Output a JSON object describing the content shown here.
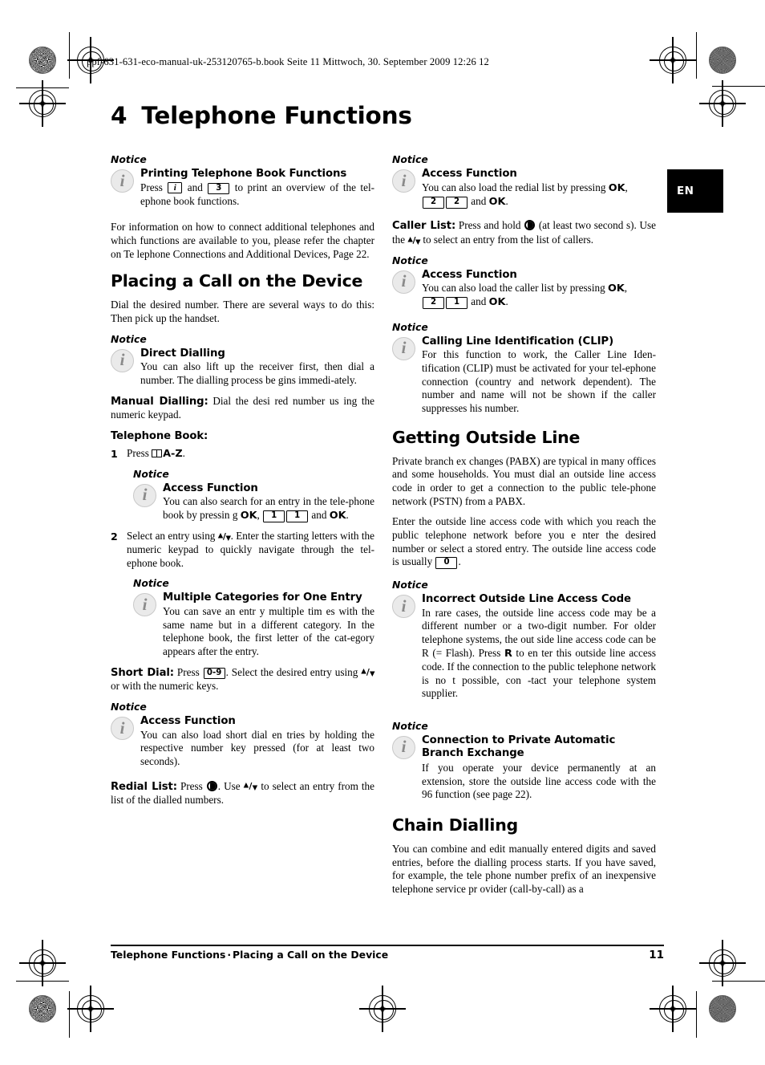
{
  "header": {
    "file_info": "ppf-631-631-eco-manual-uk-253120765-b.book  Seite 11  Mittwoch, 30. September 2009  12:26 12"
  },
  "chapter": {
    "number": "4",
    "title": "Telephone Functions"
  },
  "language_tab": {
    "label": "EN"
  },
  "left_column": {
    "notice_label_1": "Notice",
    "notice_1": {
      "title": "Printing Telephone Book Functions",
      "text_before_key1": "Press ",
      "key1": "i",
      "text_between_keys": " and ",
      "key2": "3",
      "text_after": " to print an overview of the tel-ephone book functions."
    },
    "paragraph_connect": "For information on how to connect additional telephones and which functions are available to you, please refer the chapter on Te lephone Connections and Additional Devices, Page 22.",
    "heading_placing": "Placing a Call on the Device",
    "paragraph_dial": "Dial the desired number. There are several ways to do this: Then pick up the handset.",
    "notice_label_2": "Notice",
    "notice_2": {
      "title": "Direct Dialling",
      "text": "You can also lift up the receiver first, then dial a number. The dialling process be gins immedi-ately."
    },
    "manual_dialling_lead": "Manual Dialling:",
    "manual_dialling_text": " Dial  the desi red  number us ing  the numeric keypad.",
    "telephone_book_lead": "Telephone Book:",
    "step_1": {
      "number": "1",
      "text_before_icon": "Press ",
      "icon": "book-icon",
      "label": "A-Z",
      "text_after": "."
    },
    "notice_label_3": "Notice",
    "notice_3": {
      "title": "Access Function",
      "text_1": "You can also search for an entry in the tele-phone book by pressin g ",
      "ok_1": "OK",
      "comma": ", ",
      "key1": "1",
      "key2": "1",
      "text_2": " and ",
      "ok_2": "OK",
      "period": "."
    },
    "step_2": {
      "number": "2",
      "text_before_arrows": "Select an entry using ",
      "arrows": "up-down-arrows",
      "text_after": ". Enter the starting letters with the numeric keypad to quickly navigate through the tel-ephone book."
    },
    "notice_label_4": "Notice",
    "notice_4": {
      "title": "Multiple Categories for One Entry",
      "text": "You can save an entr y multiple tim es with the same name but in a different category. In the telephone book, the first letter of the cat-egory appears after the entry."
    },
    "short_dial_lead": "Short Dial:",
    "short_dial_text_1": " Press ",
    "short_dial_key": "0-9",
    "short_dial_text_2": ". Select the desired entry using ",
    "short_dial_text_3": " or with the numeric keys.",
    "notice_label_5": "Notice",
    "notice_5": {
      "title": "Access Function",
      "text": "You can also load short dial en tries by holding the respective number key pressed (for at least two seconds)."
    },
    "redial_lead": "Redial List:",
    "redial_text_1": " Press ",
    "redial_text_2": ". Use ",
    "redial_text_3": " to select an entry from the list of the dialled numbers."
  },
  "right_column": {
    "notice_label_1": "Notice",
    "notice_1": {
      "title": "Access Function",
      "text_1": "You can also load the redial list by pressing ",
      "ok_1": "OK",
      "comma": ",",
      "key1": "2",
      "key2": "2",
      "text_2": " and ",
      "ok_2": "OK",
      "period": "."
    },
    "caller_list_lead": "Caller List:",
    "caller_list_text_1": " Press  and  hold ",
    "caller_list_text_2": " (at  least two second s). Use the ",
    "caller_list_text_3": " to select an entry from the list of callers.",
    "notice_label_2": "Notice",
    "notice_2": {
      "title": "Access Function",
      "text_1": "You can also load the caller list by pressing ",
      "ok_1": "OK",
      "comma": ",",
      "key1": "2",
      "key2": "1",
      "text_2": " and ",
      "ok_2": "OK",
      "period": "."
    },
    "notice_label_3": "Notice",
    "notice_3": {
      "title": "Calling Line Identification (CLIP)",
      "text": "For this function to work, the Caller Line Iden-tification (CLIP) must be activated for your tel-ephone connection (country and network dependent). The number and name will not be shown if the caller suppresses his number."
    },
    "heading_outside_line": "Getting Outside Line",
    "paragraph_pabx": "Private branch ex changes (PABX) are typical in many offices and some households. You must dial an outside line access code in order to get a connection to the public tele-phone network (PSTN) from a PABX.",
    "paragraph_enter_code_1": "Enter the outside line access code with which you reach the public telephone network before you e nter the desired number or select a stored entry. The outside line access code is usually ",
    "paragraph_enter_code_key": "0",
    "paragraph_enter_code_2": ".",
    "notice_label_4": "Notice",
    "notice_4": {
      "title": "Incorrect Outside Line Access Code",
      "text_1": "In rare cases, the outside line access code may be a different number or a two-digit number. For older telephone systems, the out side line access code can be R (= Flash). Press ",
      "key_r": "R",
      "text_2": " to en ter this outside line access code. If the connection to the public telephone network is no t possible, con -tact your telephone system supplier."
    },
    "notice_label_5": "Notice",
    "notice_5": {
      "title": "Connection to Private Automatic Branch Exchange",
      "text": "If you operate your  device permanently at an extension, store the outside line access code with the 96 function (see page 22)."
    },
    "heading_chain_dialling": "Chain Dialling",
    "paragraph_chain": "You can combine and edit manually entered digits and saved entries, before the dialling process starts. If you have saved, for example, the tele phone number prefix of an inexpensive telephone service pr ovider (call-by-call) as a"
  },
  "footer": {
    "breadcrumb_1": "Telephone Functions",
    "separator": "·",
    "breadcrumb_2": "Placing a Call on the Device",
    "page_number": "11"
  }
}
